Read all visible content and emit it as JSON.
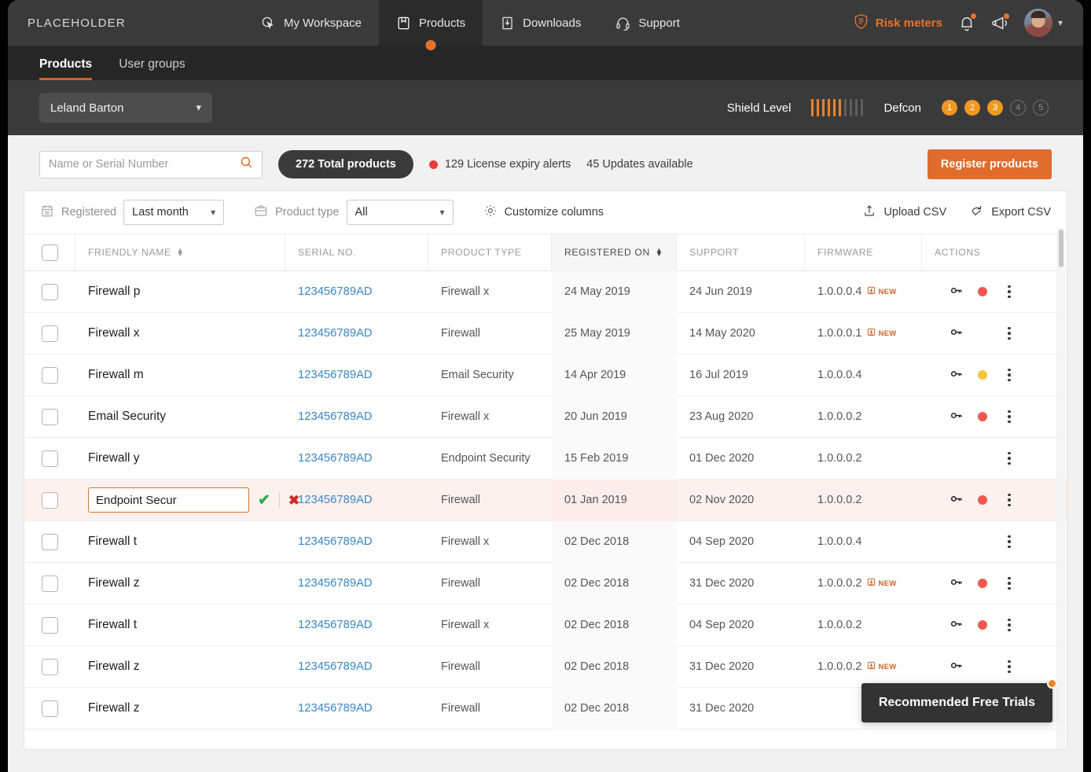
{
  "brand": "PLACEHOLDER",
  "topnav": {
    "items": [
      {
        "label": "My Workspace",
        "icon": "cursor-icon",
        "active": false
      },
      {
        "label": "Products",
        "icon": "box-icon",
        "active": true
      },
      {
        "label": "Downloads",
        "icon": "download-icon",
        "active": false
      },
      {
        "label": "Support",
        "icon": "headset-icon",
        "active": false
      }
    ],
    "risk_meters": "Risk meters",
    "icons": [
      "bell-icon",
      "megaphone-icon",
      "avatar",
      "chevron-down-icon"
    ]
  },
  "subtabs": [
    {
      "label": "Products",
      "active": true
    },
    {
      "label": "User groups",
      "active": false
    }
  ],
  "account": {
    "name": "Leland Barton",
    "shield_label": "Shield Level",
    "shield_filled": 6,
    "shield_total": 10,
    "defcon_label": "Defcon",
    "defcon_levels": [
      "1",
      "2",
      "3",
      "4",
      "5"
    ],
    "defcon_active": 3
  },
  "toolbar": {
    "search_placeholder": "Name or Serial Number",
    "search_value": "",
    "total_products": "272 Total products",
    "license_alerts": "129 License expiry alerts",
    "updates_available": "45 Updates available",
    "register_button": "Register products"
  },
  "filters": {
    "registered_label": "Registered",
    "registered_value": "Last month",
    "product_type_label": "Product type",
    "product_type_value": "All",
    "customize_columns": "Customize columns",
    "upload_csv": "Upload CSV",
    "export_csv": "Export CSV"
  },
  "table": {
    "columns": [
      {
        "key": "checkbox",
        "label": ""
      },
      {
        "key": "friendly_name",
        "label": "FRIENDLY NAME",
        "sortable": true
      },
      {
        "key": "serial_no",
        "label": "SERIAL NO."
      },
      {
        "key": "product_type",
        "label": "PRODUCT TYPE"
      },
      {
        "key": "registered_on",
        "label": "REGISTERED ON",
        "sortable": true,
        "highlight": true
      },
      {
        "key": "support",
        "label": "SUPPORT"
      },
      {
        "key": "firmware",
        "label": "FIRMWARE"
      },
      {
        "key": "actions",
        "label": "ACTIONS"
      }
    ],
    "new_badge": "NEW",
    "rows": [
      {
        "name": "Firewall p",
        "serial": "123456789AD",
        "type": "Firewall x",
        "registered": "24 May 2019",
        "support": "24 Jun 2019",
        "firmware": "1.0.0.0.4",
        "new": true,
        "key": true,
        "status": "red"
      },
      {
        "name": "Firewall x",
        "serial": "123456789AD",
        "type": "Firewall",
        "registered": "25 May 2019",
        "support": "14 May 2020",
        "firmware": "1.0.0.0.1",
        "new": true,
        "key": true,
        "status": ""
      },
      {
        "name": "Firewall m",
        "serial": "123456789AD",
        "type": "Email Security",
        "registered": "14 Apr 2019",
        "support": "16 Jul 2019",
        "firmware": "1.0.0.0.4",
        "new": false,
        "key": true,
        "status": "yellow"
      },
      {
        "name": "Email Security",
        "serial": "123456789AD",
        "type": "Firewall x",
        "registered": "20 Jun 2019",
        "support": "23 Aug 2020",
        "firmware": "1.0.0.0.2",
        "new": false,
        "key": true,
        "status": "red"
      },
      {
        "name": "Firewall y",
        "serial": "123456789AD",
        "type": "Endpoint Security",
        "registered": "15 Feb 2019",
        "support": "01 Dec 2020",
        "firmware": "1.0.0.0.2",
        "new": false,
        "key": false,
        "status": ""
      },
      {
        "name": "Endpoint Secur",
        "serial": "123456789AD",
        "type": "Firewall",
        "registered": "01 Jan 2019",
        "support": "02 Nov 2020",
        "firmware": "1.0.0.0.2",
        "new": false,
        "key": true,
        "status": "red",
        "editing": true
      },
      {
        "name": "Firewall t",
        "serial": "123456789AD",
        "type": "Firewall x",
        "registered": "02 Dec 2018",
        "support": "04 Sep 2020",
        "firmware": "1.0.0.0.4",
        "new": false,
        "key": false,
        "status": ""
      },
      {
        "name": "Firewall z",
        "serial": "123456789AD",
        "type": "Firewall",
        "registered": "02 Dec 2018",
        "support": "31 Dec 2020",
        "firmware": "1.0.0.0.2",
        "new": true,
        "key": true,
        "status": "red"
      },
      {
        "name": "Firewall t",
        "serial": "123456789AD",
        "type": "Firewall x",
        "registered": "02 Dec 2018",
        "support": "04 Sep 2020",
        "firmware": "1.0.0.0.2",
        "new": false,
        "key": true,
        "status": "red"
      },
      {
        "name": "Firewall z",
        "serial": "123456789AD",
        "type": "Firewall",
        "registered": "02 Dec 2018",
        "support": "31 Dec 2020",
        "firmware": "1.0.0.0.2",
        "new": true,
        "key": true,
        "status": ""
      },
      {
        "name": "Firewall z",
        "serial": "123456789AD",
        "type": "Firewall",
        "registered": "02 Dec 2018",
        "support": "31 Dec 2020",
        "firmware": "",
        "new": false,
        "key": false,
        "status": ""
      }
    ]
  },
  "edit_row": {
    "value": "Endpoint Secur",
    "confirm": "✔",
    "cancel": "✖"
  },
  "tooltip": {
    "text": "Recommended Free Trials"
  },
  "colors": {
    "accent": "#e06c2b",
    "link": "#3b86c4",
    "danger": "#f4584f",
    "warning": "#f6c33c",
    "dark": "#3a3a3a"
  }
}
